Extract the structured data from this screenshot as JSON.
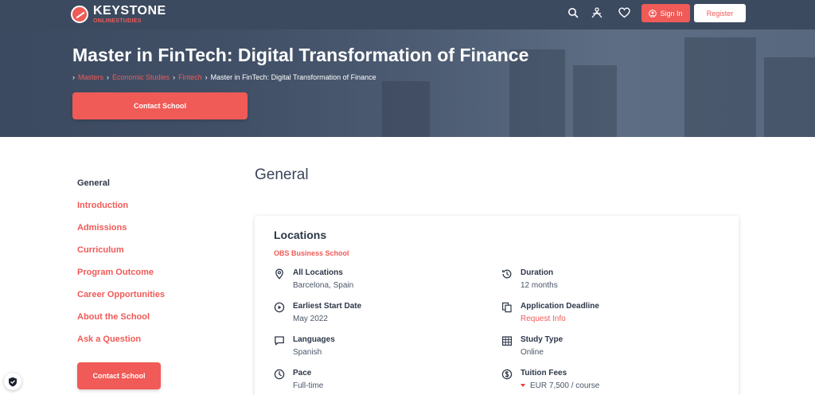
{
  "brand": {
    "name": "KEYSTONE",
    "sub": "ONLINESTUDIES"
  },
  "header": {
    "sign_in": "Sign In",
    "register": "Register"
  },
  "hero": {
    "title": "Master in FinTech: Digital Transformation of Finance",
    "breadcrumbs": [
      "Masters",
      "Economic Studies",
      "Fintech",
      "Master in FinTech: Digital Transformation of Finance"
    ],
    "contact": "Contact School"
  },
  "sidebar": {
    "items": [
      "General",
      "Introduction",
      "Admissions",
      "Curriculum",
      "Program Outcome",
      "Career Opportunities",
      "About the School",
      "Ask a Question"
    ],
    "contact": "Contact School"
  },
  "main": {
    "section_title": "General",
    "card": {
      "title": "Locations",
      "school": "OBS Business School",
      "left": [
        {
          "icon": "location-pin-icon",
          "label": "All Locations",
          "value": "Barcelona, Spain"
        },
        {
          "icon": "play-circle-icon",
          "label": "Earliest Start Date",
          "value": "May 2022"
        },
        {
          "icon": "chat-bubble-icon",
          "label": "Languages",
          "value": "Spanish"
        },
        {
          "icon": "clock-icon",
          "label": "Pace",
          "value": "Full-time"
        }
      ],
      "right": [
        {
          "icon": "history-icon",
          "label": "Duration",
          "value": "12 months"
        },
        {
          "icon": "copy-document-icon",
          "label": "Application Deadline",
          "value": "Request Info"
        },
        {
          "icon": "building-icon",
          "label": "Study Type",
          "value": "Online"
        },
        {
          "icon": "dollar-circle-icon",
          "label": "Tuition Fees",
          "value": "EUR 7,500 / course"
        }
      ]
    }
  },
  "colors": {
    "accent": "#f05a57",
    "header_bg": "#3c4a60",
    "text": "#2d3748"
  }
}
